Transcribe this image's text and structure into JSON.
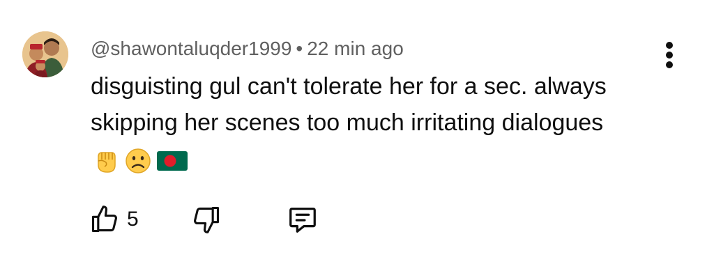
{
  "comment": {
    "author": "@shawontaluqder1999",
    "separator": "•",
    "time_ago": "22 min ago",
    "text": "disguisting gul can't tolerate her for a sec. always\nskipping her scenes too much irritating dialogues",
    "emojis": [
      "raised-fist-emoji",
      "frowning-face-emoji",
      "bangladesh-flag-emoji"
    ]
  },
  "actions": {
    "like_count": "5",
    "like_icon": "thumbs-up-icon",
    "dislike_icon": "thumbs-down-icon",
    "reply_icon": "reply-comment-icon",
    "more_icon": "more-vertical-icon"
  },
  "colors": {
    "text_primary": "#0f0f0f",
    "text_secondary": "#606060",
    "flag_green": "#006a4e",
    "flag_red": "#e21d2a",
    "emoji_yellow": "#ffcc4d"
  }
}
